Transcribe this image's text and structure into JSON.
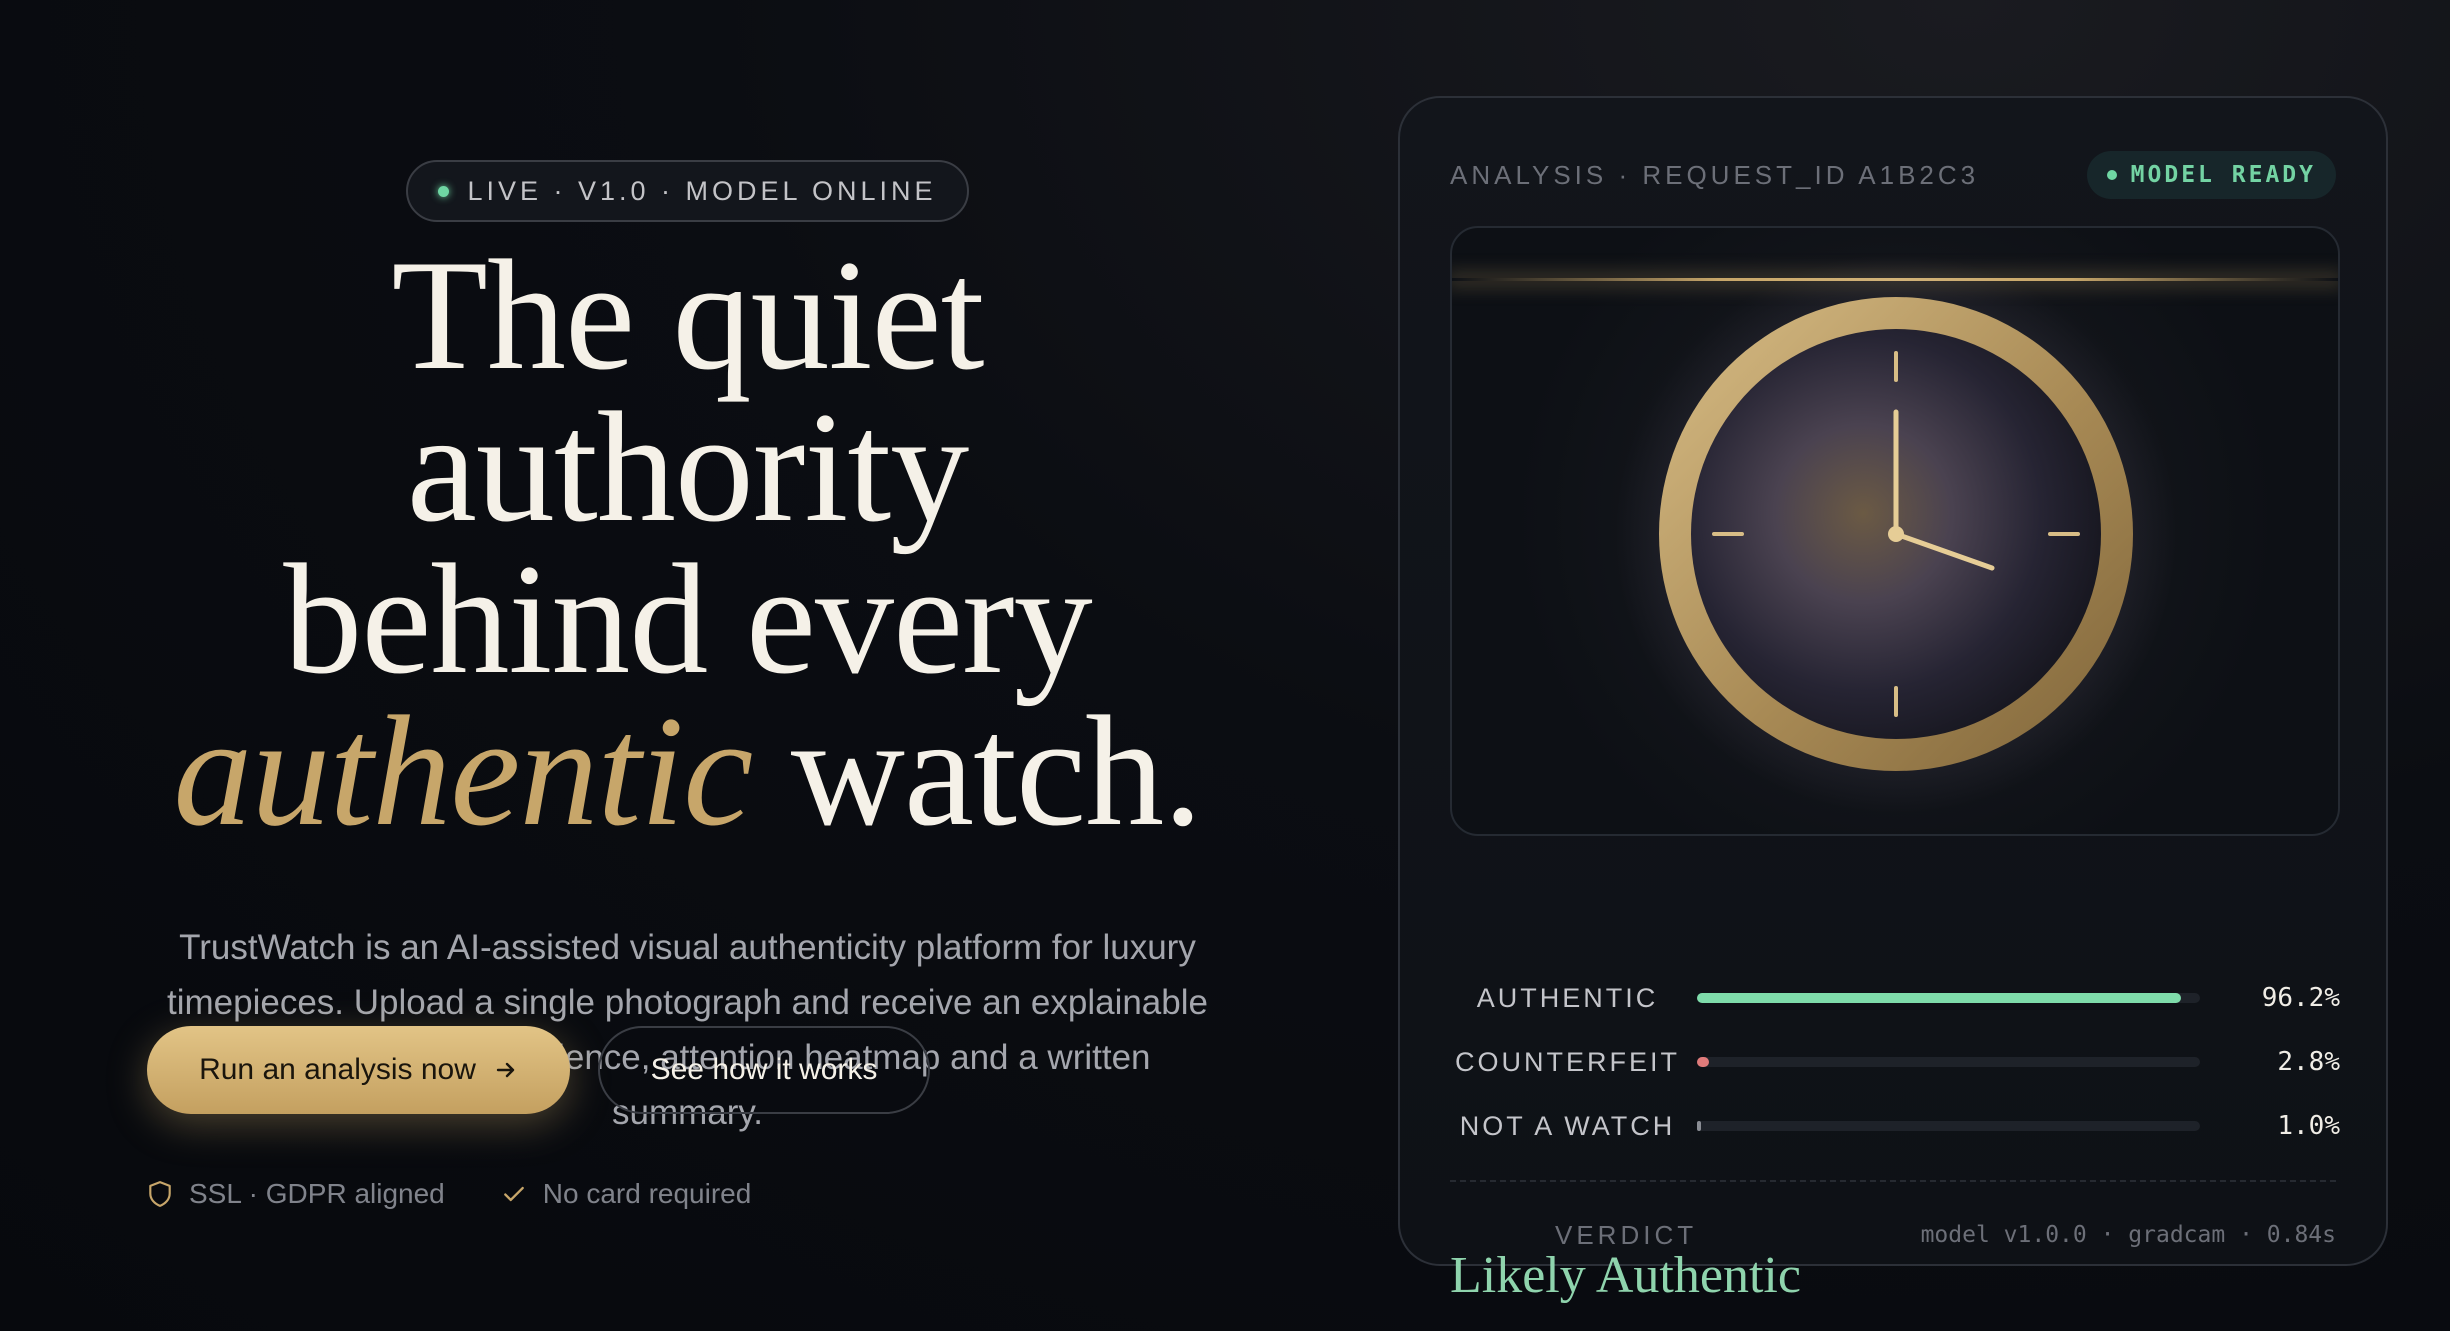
{
  "hero": {
    "pill_text": "LIVE · V1.0 · MODEL ONLINE",
    "headline_line1": "The quiet authority",
    "headline_line2": "behind every",
    "headline_accent": "authentic",
    "headline_end": " watch.",
    "lede": "TrustWatch is an AI-assisted visual authenticity platform for luxury timepieces. Upload a single photograph and receive an explainable verdict — class confidence, attention heatmap and a written summary.",
    "primary_cta": "Run an analysis now",
    "secondary_cta": "See how it works",
    "trust_items": [
      "SSL · GDPR aligned",
      "No card required"
    ]
  },
  "card": {
    "title": "ANALYSIS · REQUEST_ID A1B2C3",
    "badge": "MODEL READY",
    "scores": [
      {
        "label": "AUTHENTIC",
        "value": "96.2%",
        "fraction": 0.962,
        "color": "#7fdcab"
      },
      {
        "label": "COUNTERFEIT",
        "value": "2.8%",
        "fraction": 0.028,
        "color": "#e07b7b"
      },
      {
        "label": "NOT A WATCH",
        "value": "1.0%",
        "fraction": 0.01,
        "color": "#8a8d94"
      }
    ],
    "verdict_label": "VERDICT",
    "verdict_value": "Likely Authentic",
    "meta": "model v1.0.0 · gradcam · 0.84s"
  },
  "colors": {
    "accent_gold": "#c7a66a",
    "ready_green": "#6fd6a3"
  }
}
